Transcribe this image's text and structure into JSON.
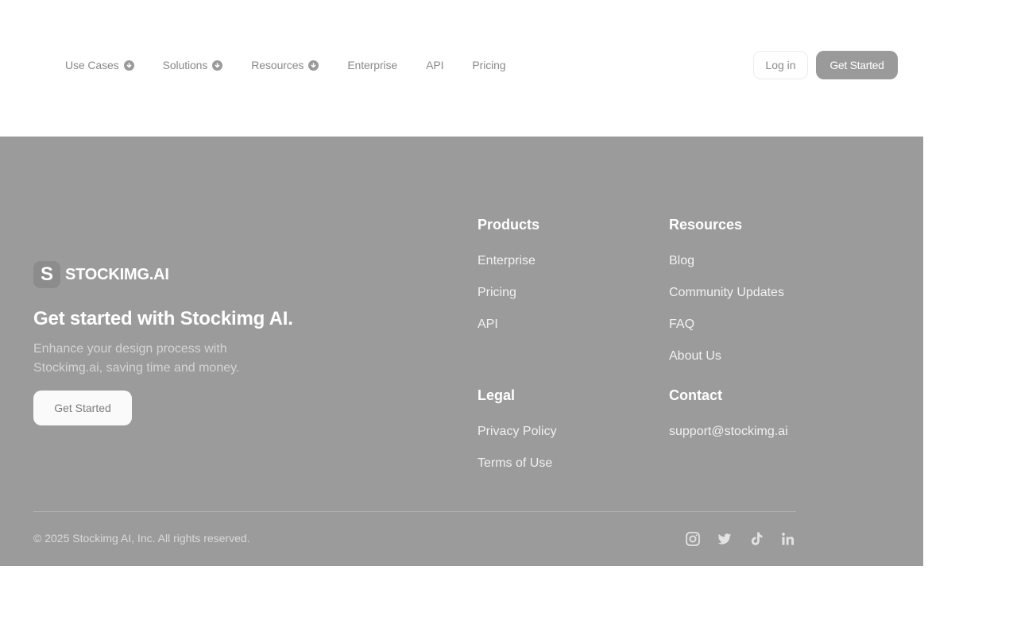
{
  "header": {
    "nav": [
      {
        "label": "Use Cases",
        "dropdown": true
      },
      {
        "label": "Solutions",
        "dropdown": true
      },
      {
        "label": "Resources",
        "dropdown": true
      },
      {
        "label": "Enterprise",
        "dropdown": false
      },
      {
        "label": "API",
        "dropdown": false
      },
      {
        "label": "Pricing",
        "dropdown": false
      }
    ],
    "login_label": "Log in",
    "get_started_label": "Get Started"
  },
  "footer": {
    "logo_letter": "S",
    "brand_name": "STOCKIMG.AI",
    "title": "Get started with Stockimg AI.",
    "subtitle": "Enhance your design process with Stockimg.ai, saving time and money.",
    "cta_label": "Get Started",
    "columns": {
      "products": {
        "heading": "Products",
        "links": [
          "Enterprise",
          "Pricing",
          "API"
        ]
      },
      "resources": {
        "heading": "Resources",
        "links": [
          "Blog",
          "Community Updates",
          "FAQ",
          "About Us"
        ]
      },
      "legal": {
        "heading": "Legal",
        "links": [
          "Privacy Policy",
          "Terms of Use"
        ]
      },
      "contact": {
        "heading": "Contact",
        "links": [
          "support@stockimg.ai"
        ]
      }
    },
    "copyright": "© 2025 Stockimg AI, Inc. All rights reserved.",
    "socials": [
      "instagram-icon",
      "twitter-icon",
      "tiktok-icon",
      "linkedin-icon"
    ]
  },
  "colors": {
    "footer_bg": "#9b9b9b",
    "primary_button": "#9a9a9a",
    "nav_text": "#8a8a8a"
  }
}
